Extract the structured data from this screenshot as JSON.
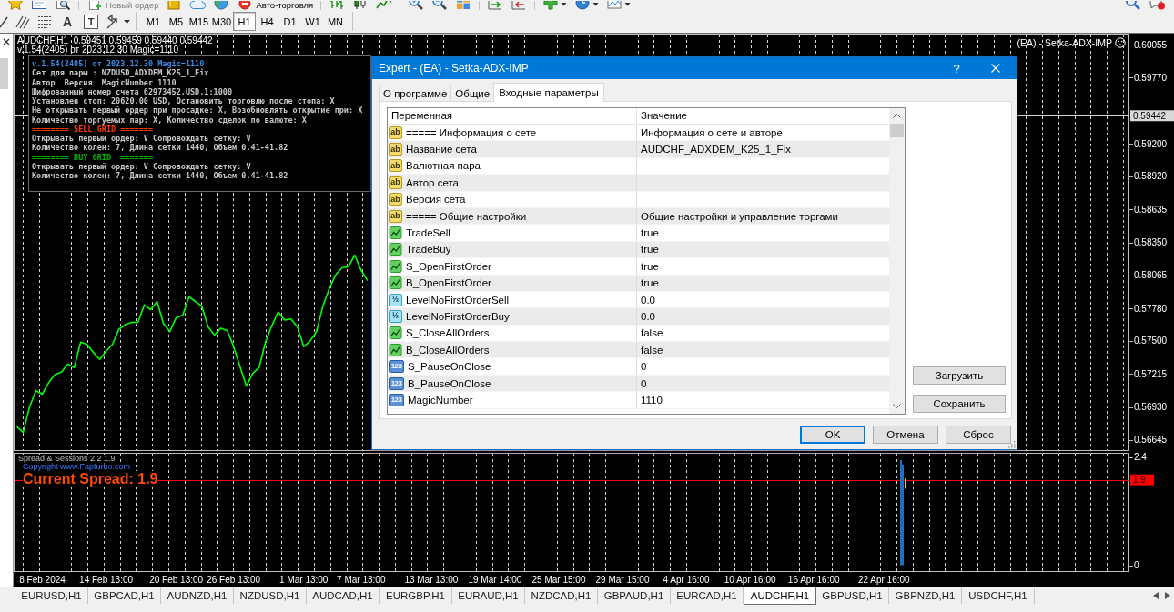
{
  "toolbar": {
    "buttons": [
      {
        "label": "Новый ордер",
        "disabled": true
      },
      {
        "label": "Авто-торговля",
        "disabled": false
      }
    ],
    "text_tool": "A",
    "label_tool": "T",
    "timeframes": [
      {
        "label": "M1",
        "selected": false
      },
      {
        "label": "M5",
        "selected": false
      },
      {
        "label": "M15",
        "selected": false
      },
      {
        "label": "M30",
        "selected": false
      },
      {
        "label": "H1",
        "selected": true
      },
      {
        "label": "H4",
        "selected": false
      },
      {
        "label": "D1",
        "selected": false
      },
      {
        "label": "W1",
        "selected": false
      },
      {
        "label": "MN",
        "selected": false
      }
    ]
  },
  "chart": {
    "header": "AUDCHF,H1  0.59451 0.59459 0.59440 0.59442",
    "version": "v.1.54(2405) от 2023.12.30 Magic=1110",
    "expert": "(EA) - Setka-ADX-IMP",
    "info_panel": [
      {
        "text": "v.1.54(2405) от 2023.12.30 Magic=1110",
        "color": "#3a8ae6"
      },
      {
        "text": "Сет для пары : NZDUSD_ADXDEM_K25_1_Fix",
        "color": "#c8c8c8"
      },
      {
        "text": "Автор  Версия  MagicNumber 1110",
        "color": "#c8c8c8"
      },
      {
        "text": "Шифрованный номер счета 62973452,USD,1:1000",
        "color": "#c8c8c8"
      },
      {
        "text": "Установлен стоп: 20620.00 USD, Остановить торговлю после стопа: X",
        "color": "#c8c8c8"
      },
      {
        "text": "Не открывать первый ордер при просадке: X, Возобновлять открытие при: X",
        "color": "#c8c8c8"
      },
      {
        "text": "Количество торгуемых пар: X, Количество сделок по валюте: X",
        "color": "#c8c8c8"
      },
      {
        "text": "======== SELL GRID =======",
        "color": "#ff3c00"
      },
      {
        "text": "Открывать первый ордер: V Сопровождать сетку: V",
        "color": "#c8c8c8"
      },
      {
        "text": "Количество колен: 7, Длина сетки 1440, Объем 0.41-41.82",
        "color": "#c8c8c8"
      },
      {
        "text": "======== BUY GRID  =======",
        "color": "#00b400"
      },
      {
        "text": "Открывать первый ордер: V Сопровождать сетку: V",
        "color": "#c8c8c8"
      },
      {
        "text": "Количество колен: 7, Длина сетки 1440, Объем 0.41-41.82",
        "color": "#c8c8c8"
      }
    ],
    "chart_data": [
      {
        "type": "line",
        "color": "#00ff00",
        "ylim": [
          0.5655,
          0.6015
        ],
        "yticks": [
          0.60055,
          {
            "value": 0.5977,
            "label": "0.59770"
          },
          {
            "value": 0.592,
            "label": "0.59200"
          },
          {
            "value": 0.5892,
            "label": "0.58920"
          },
          0.58635,
          {
            "value": 0.5835,
            "label": "0.58350"
          },
          0.58065,
          {
            "value": 0.5778,
            "label": "0.57780"
          },
          {
            "value": 0.575,
            "label": "0.57500"
          },
          0.57215,
          {
            "value": 0.5693,
            "label": "0.56930"
          },
          0.56645
        ],
        "tick_labels": "y",
        "grid": true,
        "ref_lines": [
          {
            "axis": "y",
            "value": 0.59442,
            "label": "0.59442",
            "color": "#d9d9d9"
          }
        ],
        "values": [
          0.5676,
          0.5671,
          0.5693,
          0.5707,
          0.5704,
          0.5714,
          0.5721,
          0.5723,
          0.573,
          0.5727,
          0.5749,
          0.5747,
          0.574,
          0.5734,
          0.5741,
          0.5747,
          0.576,
          0.5764,
          0.5766,
          0.5766,
          0.5781,
          0.5777,
          0.5784,
          0.5765,
          0.5758,
          0.577,
          0.5772,
          0.5788,
          0.5784,
          0.578,
          0.5762,
          0.5755,
          0.5761,
          0.5759,
          0.5745,
          0.5728,
          0.5711,
          0.5722,
          0.5727,
          0.5749,
          0.5763,
          0.5775,
          0.5768,
          0.5769,
          0.5762,
          0.5745,
          0.575,
          0.5758,
          0.578,
          0.5795,
          0.5807,
          0.5813,
          0.5814,
          0.5824,
          0.5811,
          0.5802,
          null,
          null,
          null,
          null,
          null,
          null,
          null,
          null,
          null,
          null,
          null,
          null,
          null,
          null,
          null,
          null,
          null,
          null,
          null,
          null,
          null,
          null,
          null,
          null,
          null,
          null,
          null,
          null,
          null,
          null,
          null,
          null,
          null,
          null,
          null,
          null,
          null,
          null,
          null,
          null,
          null,
          null,
          null,
          null,
          null,
          null,
          null,
          null,
          null,
          null,
          null,
          null,
          null,
          null,
          null,
          null,
          null,
          null,
          null,
          null,
          null,
          null,
          null,
          null,
          null,
          null,
          null,
          null,
          null,
          null,
          null,
          null,
          null,
          null,
          null,
          null,
          null,
          null,
          null,
          null,
          null,
          null,
          null,
          null,
          null,
          null,
          null,
          null,
          null,
          null,
          null,
          null,
          null,
          null,
          null,
          null,
          null,
          null,
          null,
          null,
          null,
          null,
          null,
          null,
          null,
          null,
          null,
          null,
          null,
          null,
          null,
          null,
          null,
          null,
          null,
          null,
          null,
          null,
          null
        ]
      },
      {
        "type": "bar",
        "title": "Spread & Sessions 2.2 1.9",
        "annotations": [
          "Copyright www.Fapturbo.com",
          "Current Spread: 1.9"
        ],
        "ylim": [
          -0.15,
          2.5
        ],
        "yticks": [
          0,
          2.4
        ],
        "grid": true,
        "ref_lines": [
          {
            "axis": "y",
            "value": 1.9,
            "label": "1.9",
            "color": "#ff0000"
          }
        ],
        "categories": [
          null,
          null,
          null,
          null,
          "8 Feb 2024",
          null,
          null,
          null,
          null,
          null,
          null,
          null,
          null,
          null,
          "14 Feb 13:00",
          null,
          null,
          null,
          null,
          null,
          null,
          null,
          null,
          null,
          null,
          "20 Feb 13:00",
          null,
          null,
          null,
          null,
          null,
          null,
          null,
          null,
          "26 Feb 13:00",
          null,
          null,
          null,
          null,
          null,
          null,
          null,
          null,
          null,
          null,
          "1 Mar 13:00",
          null,
          null,
          null,
          null,
          null,
          null,
          null,
          null,
          "7 Mar 13:00",
          null,
          null,
          null,
          null,
          null,
          null,
          null,
          null,
          null,
          null,
          "13 Mar 13:00",
          null,
          null,
          null,
          null,
          null,
          null,
          null,
          null,
          null,
          "19 Mar 14:00",
          null,
          null,
          null,
          null,
          null,
          null,
          null,
          null,
          null,
          "25 Mar 15:00",
          null,
          null,
          null,
          null,
          null,
          null,
          null,
          null,
          null,
          "29 Mar 15:00",
          null,
          null,
          null,
          null,
          null,
          null,
          null,
          null,
          null,
          "4 Apr 16:00",
          null,
          null,
          null,
          null,
          null,
          null,
          null,
          null,
          null,
          "10 Apr 16:00",
          null,
          null,
          null,
          null,
          null,
          null,
          null,
          null,
          null,
          "16 Apr 16:00",
          null,
          null,
          null,
          null,
          null,
          null,
          null,
          null,
          null,
          null,
          "22 Apr 16:00",
          null,
          null,
          null,
          null,
          null,
          null,
          null,
          null,
          null,
          null,
          null,
          null,
          null,
          null,
          null,
          null,
          null,
          null,
          null,
          null,
          null,
          null,
          null,
          null,
          null,
          null,
          null,
          null,
          null,
          null,
          null,
          null,
          null,
          null,
          null,
          null,
          null,
          null
        ],
        "series": [
          {
            "color": "#1f6fc0",
            "values": [
              null,
              null,
              null,
              null,
              null,
              null,
              null,
              null,
              null,
              null,
              null,
              null,
              null,
              null,
              null,
              null,
              null,
              null,
              null,
              null,
              null,
              null,
              null,
              null,
              null,
              null,
              null,
              null,
              null,
              null,
              null,
              null,
              null,
              null,
              null,
              null,
              null,
              null,
              null,
              null,
              null,
              null,
              null,
              null,
              null,
              null,
              null,
              null,
              null,
              null,
              null,
              null,
              null,
              null,
              null,
              null,
              null,
              null,
              null,
              null,
              null,
              null,
              null,
              null,
              null,
              null,
              null,
              null,
              null,
              null,
              null,
              null,
              null,
              null,
              null,
              null,
              null,
              null,
              null,
              null,
              null,
              null,
              null,
              null,
              null,
              null,
              null,
              null,
              null,
              null,
              null,
              null,
              null,
              null,
              null,
              null,
              null,
              null,
              null,
              null,
              null,
              null,
              null,
              null,
              null,
              null,
              null,
              null,
              null,
              null,
              null,
              null,
              null,
              null,
              null,
              null,
              null,
              null,
              null,
              null,
              null,
              null,
              null,
              null,
              null,
              null,
              null,
              null,
              null,
              null,
              null,
              null,
              null,
              null,
              null,
              null,
              null,
              null,
              null,
              2.34,
              null,
              null,
              null,
              null,
              null,
              null,
              null,
              null,
              null,
              null,
              null,
              null,
              null,
              null,
              null,
              null,
              null,
              null,
              null,
              null,
              null,
              null,
              null,
              null,
              null,
              null,
              null,
              null,
              null,
              null,
              null,
              null,
              null,
              null,
              null
            ]
          },
          {
            "color": "#1f6fc0",
            "values": [
              null,
              null,
              null,
              null,
              null,
              null,
              null,
              null,
              null,
              null,
              null,
              null,
              null,
              null,
              null,
              null,
              null,
              null,
              null,
              null,
              null,
              null,
              null,
              null,
              null,
              null,
              null,
              null,
              null,
              null,
              null,
              null,
              null,
              null,
              null,
              null,
              null,
              null,
              null,
              null,
              null,
              null,
              null,
              null,
              null,
              null,
              null,
              null,
              null,
              null,
              null,
              null,
              null,
              null,
              null,
              null,
              null,
              null,
              null,
              null,
              null,
              null,
              null,
              null,
              null,
              null,
              null,
              null,
              null,
              null,
              null,
              null,
              null,
              null,
              null,
              null,
              null,
              null,
              null,
              null,
              null,
              null,
              null,
              null,
              null,
              null,
              null,
              null,
              null,
              null,
              null,
              null,
              null,
              null,
              null,
              null,
              null,
              null,
              null,
              null,
              null,
              null,
              null,
              null,
              null,
              null,
              null,
              null,
              null,
              null,
              null,
              null,
              null,
              null,
              null,
              null,
              null,
              null,
              null,
              null,
              null,
              null,
              null,
              null,
              null,
              null,
              null,
              null,
              null,
              null,
              null,
              null,
              null,
              null,
              null,
              null,
              null,
              null,
              null,
              2.24,
              null,
              null,
              null,
              null,
              null,
              null,
              null,
              null,
              null,
              null,
              null,
              null,
              null,
              null,
              null,
              null,
              null,
              null,
              null,
              null,
              null,
              null,
              null,
              null,
              null,
              null,
              null,
              null,
              null,
              null,
              null,
              null,
              null,
              null,
              null
            ]
          },
          {
            "color": "#ffd700",
            "values": [
              null,
              null,
              null,
              null,
              null,
              null,
              null,
              null,
              null,
              null,
              null,
              null,
              null,
              null,
              null,
              null,
              null,
              null,
              null,
              null,
              null,
              null,
              null,
              null,
              null,
              null,
              null,
              null,
              null,
              null,
              null,
              null,
              null,
              null,
              null,
              null,
              null,
              null,
              null,
              null,
              null,
              null,
              null,
              null,
              null,
              null,
              null,
              null,
              null,
              null,
              null,
              null,
              null,
              null,
              null,
              null,
              null,
              null,
              null,
              null,
              null,
              null,
              null,
              null,
              null,
              null,
              null,
              null,
              null,
              null,
              null,
              null,
              null,
              null,
              null,
              null,
              null,
              null,
              null,
              null,
              null,
              null,
              null,
              null,
              null,
              null,
              null,
              null,
              null,
              null,
              null,
              null,
              null,
              null,
              null,
              null,
              null,
              null,
              null,
              null,
              null,
              null,
              null,
              null,
              null,
              null,
              null,
              null,
              null,
              null,
              null,
              null,
              null,
              null,
              null,
              null,
              null,
              null,
              null,
              null,
              null,
              null,
              null,
              null,
              null,
              null,
              null,
              null,
              null,
              null,
              null,
              null,
              null,
              null,
              null,
              null,
              null,
              null,
              null,
              0.23,
              null,
              null,
              null,
              null,
              null,
              null,
              null,
              null,
              null,
              null,
              null,
              null,
              null,
              null,
              null,
              null,
              null,
              null,
              null,
              null,
              null,
              null,
              null,
              null,
              null,
              null,
              null,
              null,
              null,
              null,
              null,
              null,
              null,
              null,
              null
            ],
            "base": [
              null,
              null,
              null,
              null,
              null,
              null,
              null,
              null,
              null,
              null,
              null,
              null,
              null,
              null,
              null,
              null,
              null,
              null,
              null,
              null,
              null,
              null,
              null,
              null,
              null,
              null,
              null,
              null,
              null,
              null,
              null,
              null,
              null,
              null,
              null,
              null,
              null,
              null,
              null,
              null,
              null,
              null,
              null,
              null,
              null,
              null,
              null,
              null,
              null,
              null,
              null,
              null,
              null,
              null,
              null,
              null,
              null,
              null,
              null,
              null,
              null,
              null,
              null,
              null,
              null,
              null,
              null,
              null,
              null,
              null,
              null,
              null,
              null,
              null,
              null,
              null,
              null,
              null,
              null,
              null,
              null,
              null,
              null,
              null,
              null,
              null,
              null,
              null,
              null,
              null,
              null,
              null,
              null,
              null,
              null,
              null,
              null,
              null,
              null,
              null,
              null,
              null,
              null,
              null,
              null,
              null,
              null,
              null,
              null,
              null,
              null,
              null,
              null,
              null,
              null,
              null,
              null,
              null,
              null,
              null,
              null,
              null,
              null,
              null,
              null,
              null,
              null,
              null,
              null,
              null,
              null,
              null,
              null,
              null,
              null,
              null,
              null,
              null,
              null,
              1.7,
              null,
              null,
              null,
              null,
              null,
              null,
              null,
              null,
              null,
              null,
              null,
              null,
              null,
              null,
              null,
              null,
              null,
              null,
              null,
              null,
              null,
              null,
              null,
              null,
              null,
              null,
              null,
              null,
              null,
              null,
              null,
              null,
              null,
              null,
              null
            ]
          }
        ]
      }
    ]
  },
  "dialog": {
    "title": "Expert - (EA) - Setka-ADX-IMP",
    "help": "?",
    "tabs": [
      {
        "label": "О программе",
        "selected": false
      },
      {
        "label": "Общие",
        "selected": false
      },
      {
        "label": "Входные параметры",
        "selected": true
      }
    ],
    "columns": [
      "Переменная",
      "Значение"
    ],
    "rows": [
      {
        "kind": "string",
        "type_label": "ab",
        "name": "===== Информация о сете",
        "value": "Информация о сете и авторе"
      },
      {
        "kind": "string",
        "type_label": "ab",
        "name": "Название сета",
        "value": "AUDCHF_ADXDEM_K25_1_Fix"
      },
      {
        "kind": "string",
        "type_label": "ab",
        "name": "Валютная пара"
      },
      {
        "kind": "string",
        "type_label": "ab",
        "name": "Автор сета"
      },
      {
        "kind": "string",
        "type_label": "ab",
        "name": "Версия сета"
      },
      {
        "kind": "string",
        "type_label": "ab",
        "name": "===== Общие настройки",
        "value": "Общие настройки и управление торгами"
      },
      {
        "kind": "bool",
        "name": "TradeSell",
        "value": "true"
      },
      {
        "kind": "bool",
        "name": "TradeBuy",
        "value": "true"
      },
      {
        "kind": "bool",
        "name": "S_OpenFirstOrder",
        "value": "true"
      },
      {
        "kind": "bool",
        "name": "B_OpenFirstOrder",
        "value": "true"
      },
      {
        "kind": "double",
        "type_label": "½",
        "name": "LevelNoFirstOrderSell",
        "value": "0.0"
      },
      {
        "kind": "double",
        "type_label": "½",
        "name": "LevelNoFirstOrderBuy",
        "value": "0.0"
      },
      {
        "kind": "bool",
        "name": "S_CloseAllOrders",
        "value": "false"
      },
      {
        "kind": "bool",
        "name": "B_CloseAllOrders",
        "value": "false"
      },
      {
        "kind": "int",
        "type_label": "123",
        "name": "S_PauseOnClose",
        "value": "0"
      },
      {
        "kind": "int",
        "type_label": "123",
        "name": "B_PauseOnClose",
        "value": "0"
      },
      {
        "kind": "int",
        "type_label": "123",
        "name": "MagicNumber",
        "value": "1110"
      }
    ],
    "side_buttons": [
      "Загрузить",
      "Сохранить"
    ],
    "buttons": [
      {
        "label": "OK",
        "default": true
      },
      {
        "label": "Отмена",
        "default": false
      },
      {
        "label": "Сброс",
        "default": false
      }
    ]
  },
  "symbol_tabs": [
    {
      "label": "EURUSD,H1",
      "selected": false
    },
    {
      "label": "GBPCAD,H1",
      "selected": false
    },
    {
      "label": "AUDNZD,H1",
      "selected": false
    },
    {
      "label": "NZDUSD,H1",
      "selected": false
    },
    {
      "label": "AUDCAD,H1",
      "selected": false
    },
    {
      "label": "EURGBP,H1",
      "selected": false
    },
    {
      "label": "EURAUD,H1",
      "selected": false
    },
    {
      "label": "NZDCAD,H1",
      "selected": false
    },
    {
      "label": "GBPAUD,H1",
      "selected": false
    },
    {
      "label": "EURCAD,H1",
      "selected": false
    },
    {
      "label": "AUDCHF,H1",
      "selected": true
    },
    {
      "label": "GBPUSD,H1",
      "selected": false
    },
    {
      "label": "GBPNZD,H1",
      "selected": false
    },
    {
      "label": "USDCHF,H1",
      "selected": false
    }
  ]
}
